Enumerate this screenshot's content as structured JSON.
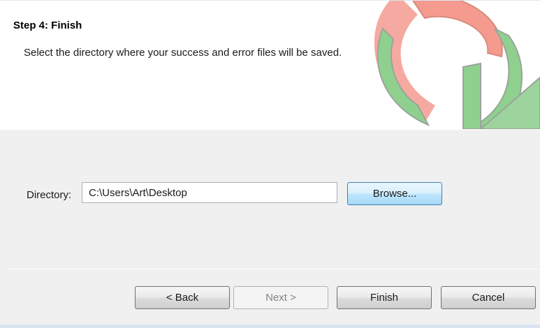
{
  "header": {
    "step_title": "Step 4: Finish",
    "description": "Select the directory where your success and error files will be saved.",
    "logo_icon": "refresh-arrows-logo",
    "logo_colors": {
      "red": "#f49a8f",
      "green": "#8fd08f",
      "outline": "#9aa59a"
    }
  },
  "form": {
    "directory_label": "Directory:",
    "directory_value": "C:\\Users\\Art\\Desktop",
    "browse_label": "Browse..."
  },
  "footer": {
    "back_label": "< Back",
    "next_label": "Next >",
    "finish_label": "Finish",
    "cancel_label": "Cancel"
  }
}
